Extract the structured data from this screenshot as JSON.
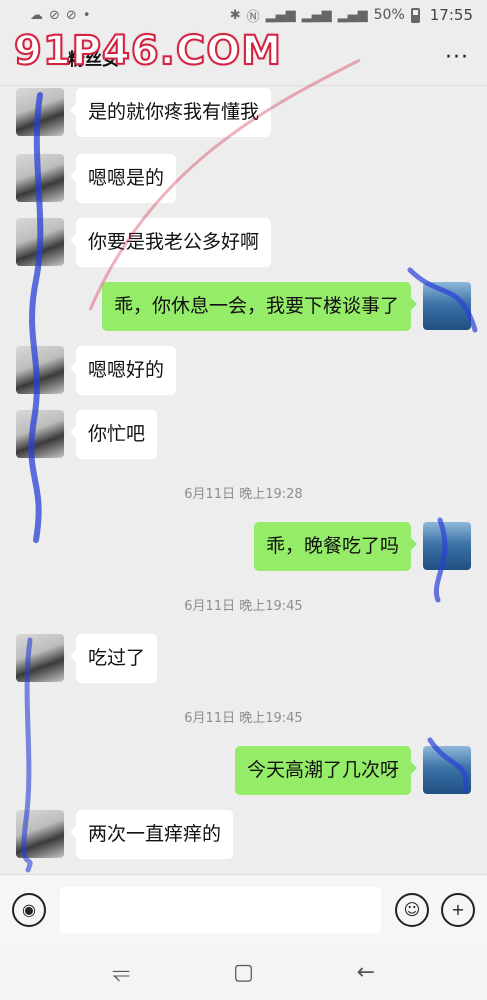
{
  "status_bar": {
    "left_icons": [
      "cloud-icon",
      "sync-icon",
      "sync-icon",
      "dot-icon"
    ],
    "battery": "50%",
    "time": "17:55"
  },
  "header": {
    "title": "粉丝女",
    "watermark": "91P46.COM"
  },
  "messages": [
    {
      "side": "left",
      "text": "是的就你疼我有懂我"
    },
    {
      "side": "left",
      "text": "嗯嗯是的"
    },
    {
      "side": "left",
      "text": "你要是我老公多好啊"
    },
    {
      "side": "right",
      "text": "乖，你休息一会，我要下楼谈事了"
    },
    {
      "side": "left",
      "text": "嗯嗯好的"
    },
    {
      "side": "left",
      "text": "你忙吧"
    },
    {
      "side": "time",
      "text": "6月11日 晚上19:28"
    },
    {
      "side": "right",
      "text": "乖，晚餐吃了吗"
    },
    {
      "side": "time",
      "text": "6月11日 晚上19:45"
    },
    {
      "side": "left",
      "text": "吃过了"
    },
    {
      "side": "time",
      "text": "6月11日 晚上19:45"
    },
    {
      "side": "right",
      "text": "今天高潮了几次呀"
    },
    {
      "side": "left",
      "text": "两次一直痒痒的"
    }
  ],
  "input": {
    "value": "",
    "voice_icon": "voice-icon",
    "emoji_icon": "emoji-icon",
    "plus_icon": "plus-icon"
  },
  "nav": {
    "icons": [
      "recents-icon",
      "home-icon",
      "back-icon"
    ]
  }
}
